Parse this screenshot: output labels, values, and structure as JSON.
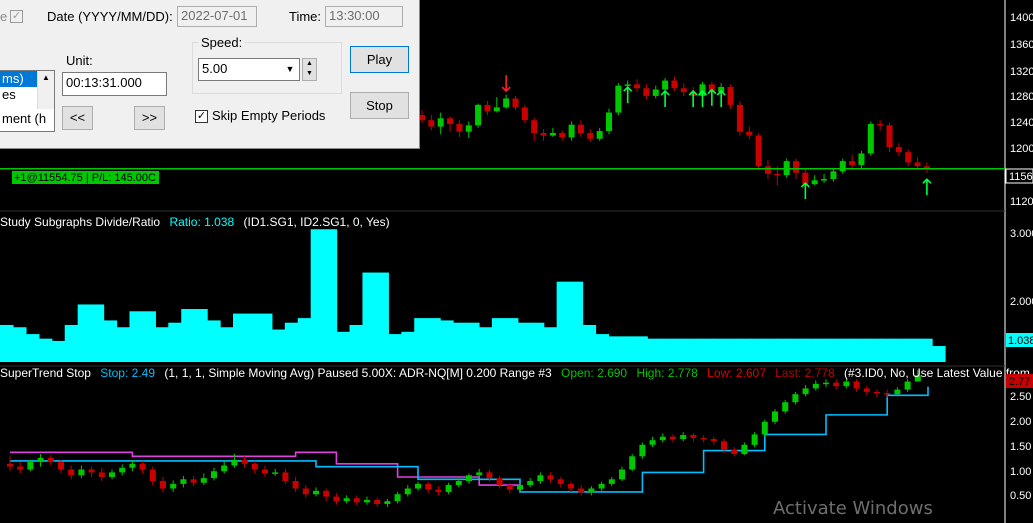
{
  "replay": {
    "date_label": "Date (YYYY/MM/DD):",
    "date_value": "2022-07-01",
    "time_label": "Time:",
    "time_value": "13:30:00",
    "left_cut_label": "e",
    "unit_label": "Unit:",
    "unit_value": "00:13:31.000",
    "list_items": [
      "ms)",
      "es",
      "ment (h"
    ],
    "back_label": "<<",
    "forward_label": ">>",
    "speed_label": "Speed:",
    "speed_value": "5.00",
    "skip_label": "Skip Empty Periods",
    "skip_checked": true,
    "play_label": "Play",
    "stop_label": "Stop"
  },
  "price_pane": {
    "axis_labels": [
      "1400",
      "1360",
      "1320",
      "1280",
      "1240",
      "1200",
      "1160",
      "1120"
    ],
    "current_price_box": "1156",
    "position_label": "+1@11554.75 | P/L: 145.00C"
  },
  "ratio_pane": {
    "title": "Study Subgraphs Divide/Ratio",
    "ratio_text": "Ratio: 1.038",
    "params": "(ID1.SG1, ID2.SG1, 0, Yes)",
    "axis_labels": [
      "3.000",
      "2.000"
    ],
    "last_value_box": "1.038"
  },
  "supertrend_pane": {
    "title": "SuperTrend Stop",
    "stop_text": "Stop: 2.49",
    "params": "(1, 1, 1, Simple Moving Avg)  Paused 5.00X: ADR-NQ[M]  0.200 Range  #3",
    "open_text": "Open: 2.690",
    "high_text": "High: 2.778",
    "low_text": "Low: 2.607",
    "last_text": "Last: 2.778",
    "tail_text": "(#3.ID0, No, Use Latest Value from Corre",
    "axis_labels": [
      "2.50",
      "2.00",
      "1.50",
      "1.00",
      "0.50"
    ],
    "last_value_box": "2.77"
  },
  "watermark": "Activate Windows",
  "colors": {
    "up": "#00c800",
    "down": "#c80000",
    "ratio": "#00ffff",
    "position_line": "#00c800",
    "stop_line_up": "#00bfff",
    "stop_line_down": "#e040e0",
    "arrow": "#00ff40"
  },
  "chart_data": [
    {
      "type": "candlestick",
      "title": "",
      "y_ticks": [
        1400,
        1360,
        1320,
        1280,
        1240,
        1200,
        1160,
        1120
      ],
      "ylim": [
        1090,
        1420
      ],
      "position_line": 1156,
      "candles": [
        [
          1240,
          1232,
          1248,
          1228
        ],
        [
          1232,
          1222,
          1240,
          1216
        ],
        [
          1222,
          1235,
          1244,
          1210
        ],
        [
          1235,
          1226,
          1238,
          1214
        ],
        [
          1226,
          1214,
          1232,
          1206
        ],
        [
          1214,
          1224,
          1230,
          1204
        ],
        [
          1224,
          1256,
          1258,
          1220
        ],
        [
          1256,
          1246,
          1262,
          1240
        ],
        [
          1246,
          1252,
          1268,
          1244
        ],
        [
          1252,
          1266,
          1272,
          1250
        ],
        [
          1266,
          1252,
          1270,
          1248
        ],
        [
          1252,
          1232,
          1256,
          1228
        ],
        [
          1232,
          1212,
          1236,
          1200
        ],
        [
          1212,
          1208,
          1218,
          1200
        ],
        [
          1208,
          1212,
          1220,
          1206
        ],
        [
          1212,
          1205,
          1216,
          1200
        ],
        [
          1205,
          1225,
          1230,
          1200
        ],
        [
          1225,
          1212,
          1232,
          1206
        ],
        [
          1212,
          1203,
          1218,
          1198
        ],
        [
          1203,
          1215,
          1220,
          1200
        ],
        [
          1215,
          1244,
          1250,
          1210
        ],
        [
          1244,
          1286,
          1290,
          1240
        ],
        [
          1286,
          1288,
          1294,
          1282
        ],
        [
          1288,
          1282,
          1296,
          1276
        ],
        [
          1282,
          1270,
          1288,
          1264
        ],
        [
          1270,
          1280,
          1286,
          1266
        ],
        [
          1280,
          1294,
          1298,
          1276
        ],
        [
          1294,
          1282,
          1300,
          1278
        ],
        [
          1282,
          1276,
          1290,
          1270
        ],
        [
          1276,
          1270,
          1284,
          1264
        ],
        [
          1270,
          1288,
          1292,
          1266
        ],
        [
          1288,
          1276,
          1292,
          1272
        ],
        [
          1276,
          1284,
          1290,
          1270
        ],
        [
          1284,
          1256,
          1288,
          1250
        ],
        [
          1256,
          1214,
          1262,
          1208
        ],
        [
          1214,
          1208,
          1222,
          1202
        ],
        [
          1208,
          1160,
          1212,
          1154
        ],
        [
          1160,
          1148,
          1170,
          1140
        ],
        [
          1148,
          1146,
          1160,
          1130
        ],
        [
          1146,
          1168,
          1172,
          1142
        ],
        [
          1168,
          1150,
          1172,
          1140
        ],
        [
          1150,
          1132,
          1156,
          1126
        ],
        [
          1132,
          1138,
          1146,
          1130
        ],
        [
          1138,
          1140,
          1148,
          1134
        ],
        [
          1140,
          1152,
          1156,
          1136
        ],
        [
          1152,
          1168,
          1172,
          1148
        ],
        [
          1168,
          1162,
          1178,
          1154
        ],
        [
          1162,
          1180,
          1184,
          1156
        ],
        [
          1180,
          1226,
          1230,
          1176
        ],
        [
          1226,
          1224,
          1232,
          1216
        ],
        [
          1224,
          1190,
          1228,
          1182
        ],
        [
          1190,
          1182,
          1196,
          1176
        ],
        [
          1182,
          1166,
          1186,
          1160
        ],
        [
          1166,
          1160,
          1174,
          1154
        ],
        [
          1160,
          1156,
          1166,
          1150
        ]
      ]
    },
    {
      "type": "bar",
      "title": "Study Subgraphs Divide/Ratio",
      "y_ticks": [
        3.0,
        2.0
      ],
      "ylim": [
        0.6,
        4.0
      ],
      "values": [
        1.5,
        1.45,
        1.3,
        1.2,
        1.15,
        1.5,
        1.95,
        1.95,
        1.6,
        1.45,
        1.8,
        1.8,
        1.45,
        1.55,
        1.85,
        1.85,
        1.6,
        1.45,
        1.75,
        1.75,
        1.75,
        1.4,
        1.55,
        1.65,
        3.6,
        3.6,
        1.35,
        1.5,
        2.65,
        2.65,
        1.3,
        1.35,
        1.65,
        1.65,
        1.6,
        1.55,
        1.55,
        1.45,
        1.65,
        1.65,
        1.55,
        1.55,
        1.45,
        2.45,
        2.45,
        1.5,
        1.3,
        1.25,
        1.25,
        1.25,
        1.2,
        1.2,
        1.2,
        1.2,
        1.2,
        1.2,
        1.2,
        1.2,
        1.2,
        1.2,
        1.2,
        1.2,
        1.2,
        1.2,
        1.2,
        1.2,
        1.2,
        1.2,
        1.2,
        1.2,
        1.2,
        1.2,
        1.038
      ]
    },
    {
      "type": "candlestick",
      "title": "SuperTrend Stop",
      "y_ticks": [
        2.5,
        2.0,
        1.5,
        1.0,
        0.5
      ],
      "ylim": [
        0.12,
        2.85
      ],
      "candles": [
        [
          1.15,
          1.1,
          1.28,
          1.02
        ],
        [
          1.1,
          1.05,
          1.18,
          0.98
        ],
        [
          1.05,
          1.18,
          1.22,
          1.02
        ],
        [
          1.18,
          1.25,
          1.32,
          1.1
        ],
        [
          1.25,
          1.18,
          1.3,
          1.12
        ],
        [
          1.18,
          1.05,
          1.22,
          0.98
        ],
        [
          1.05,
          0.95,
          1.12,
          0.88
        ],
        [
          0.95,
          1.05,
          1.12,
          0.9
        ],
        [
          1.05,
          1.0,
          1.1,
          0.92
        ],
        [
          1.0,
          0.92,
          1.08,
          0.85
        ],
        [
          0.92,
          1.0,
          1.05,
          0.88
        ],
        [
          1.0,
          1.08,
          1.14,
          0.95
        ],
        [
          1.08,
          1.15,
          1.22,
          1.02
        ],
        [
          1.15,
          1.05,
          1.2,
          0.98
        ],
        [
          1.05,
          0.85,
          1.1,
          0.78
        ],
        [
          0.85,
          0.72,
          0.92,
          0.65
        ],
        [
          0.72,
          0.8,
          0.86,
          0.66
        ],
        [
          0.8,
          0.88,
          0.94,
          0.74
        ],
        [
          0.88,
          0.82,
          0.94,
          0.76
        ],
        [
          0.82,
          0.9,
          0.98,
          0.78
        ],
        [
          0.9,
          1.02,
          1.08,
          0.86
        ],
        [
          1.02,
          1.12,
          1.2,
          0.98
        ],
        [
          1.12,
          1.22,
          1.32,
          1.08
        ],
        [
          1.22,
          1.15,
          1.28,
          1.08
        ],
        [
          1.15,
          1.05,
          1.2,
          0.98
        ],
        [
          1.05,
          0.98,
          1.12,
          0.92
        ],
        [
          0.98,
          1.0,
          1.06,
          0.94
        ],
        [
          1.0,
          0.85,
          1.06,
          0.8
        ],
        [
          0.85,
          0.72,
          0.92,
          0.66
        ],
        [
          0.72,
          0.62,
          0.78,
          0.56
        ],
        [
          0.62,
          0.68,
          0.74,
          0.58
        ],
        [
          0.68,
          0.58,
          0.72,
          0.5
        ],
        [
          0.58,
          0.5,
          0.64,
          0.44
        ],
        [
          0.5,
          0.55,
          0.6,
          0.46
        ],
        [
          0.55,
          0.48,
          0.6,
          0.42
        ],
        [
          0.48,
          0.52,
          0.58,
          0.44
        ],
        [
          0.52,
          0.45,
          0.56,
          0.4
        ],
        [
          0.45,
          0.5,
          0.54,
          0.4
        ],
        [
          0.5,
          0.62,
          0.66,
          0.46
        ],
        [
          0.62,
          0.72,
          0.78,
          0.58
        ],
        [
          0.72,
          0.8,
          0.84,
          0.68
        ],
        [
          0.8,
          0.7,
          0.84,
          0.64
        ],
        [
          0.7,
          0.66,
          0.76,
          0.6
        ],
        [
          0.66,
          0.78,
          0.82,
          0.62
        ],
        [
          0.78,
          0.85,
          0.9,
          0.74
        ],
        [
          0.85,
          0.95,
          0.98,
          0.8
        ],
        [
          0.95,
          1.0,
          1.06,
          0.9
        ],
        [
          1.0,
          0.9,
          1.05,
          0.84
        ],
        [
          0.9,
          0.78,
          0.94,
          0.72
        ],
        [
          0.78,
          0.7,
          0.82,
          0.64
        ],
        [
          0.7,
          0.78,
          0.82,
          0.66
        ],
        [
          0.78,
          0.85,
          0.9,
          0.74
        ],
        [
          0.85,
          0.95,
          1.0,
          0.8
        ],
        [
          0.95,
          0.88,
          1.0,
          0.82
        ],
        [
          0.88,
          0.8,
          0.92,
          0.74
        ],
        [
          0.8,
          0.72,
          0.84,
          0.66
        ],
        [
          0.72,
          0.65,
          0.78,
          0.6
        ],
        [
          0.65,
          0.72,
          0.76,
          0.6
        ],
        [
          0.72,
          0.8,
          0.84,
          0.68
        ],
        [
          0.8,
          0.88,
          0.92,
          0.76
        ],
        [
          0.88,
          1.05,
          1.1,
          0.85
        ],
        [
          1.05,
          1.28,
          1.32,
          1.02
        ],
        [
          1.28,
          1.48,
          1.52,
          1.24
        ],
        [
          1.48,
          1.56,
          1.62,
          1.44
        ],
        [
          1.56,
          1.62,
          1.68,
          1.52
        ],
        [
          1.62,
          1.58,
          1.66,
          1.52
        ],
        [
          1.58,
          1.65,
          1.7,
          1.54
        ],
        [
          1.65,
          1.6,
          1.68,
          1.54
        ],
        [
          1.6,
          1.58,
          1.64,
          1.52
        ],
        [
          1.58,
          1.54,
          1.62,
          1.48
        ],
        [
          1.54,
          1.4,
          1.58,
          1.34
        ],
        [
          1.4,
          1.32,
          1.44,
          1.28
        ],
        [
          1.32,
          1.48,
          1.52,
          1.3
        ],
        [
          1.48,
          1.66,
          1.7,
          1.44
        ],
        [
          1.66,
          1.88,
          1.92,
          1.62
        ],
        [
          1.88,
          2.06,
          2.1,
          1.84
        ],
        [
          2.06,
          2.22,
          2.26,
          2.02
        ],
        [
          2.22,
          2.36,
          2.4,
          2.18
        ],
        [
          2.36,
          2.46,
          2.52,
          2.32
        ],
        [
          2.46,
          2.54,
          2.6,
          2.42
        ],
        [
          2.54,
          2.56,
          2.62,
          2.48
        ],
        [
          2.56,
          2.5,
          2.62,
          2.44
        ],
        [
          2.5,
          2.58,
          2.64,
          2.46
        ],
        [
          2.58,
          2.46,
          2.62,
          2.4
        ],
        [
          2.46,
          2.4,
          2.5,
          2.34
        ],
        [
          2.4,
          2.38,
          2.44,
          2.3
        ],
        [
          2.38,
          2.36,
          2.44,
          2.3
        ],
        [
          2.36,
          2.44,
          2.48,
          2.32
        ],
        [
          2.44,
          2.58,
          2.62,
          2.4
        ],
        [
          2.58,
          2.69,
          2.778,
          2.607
        ]
      ],
      "stop_up": [
        [
          0,
          1.2
        ],
        [
          22,
          1.2
        ],
        [
          30,
          1.1
        ],
        [
          40,
          0.88
        ],
        [
          50,
          0.66
        ],
        [
          56,
          0.66
        ],
        [
          62,
          1.0
        ],
        [
          68,
          1.38
        ],
        [
          74,
          1.66
        ],
        [
          80,
          2.0
        ],
        [
          86,
          2.34
        ],
        [
          90,
          2.49
        ]
      ],
      "stop_down": [
        [
          0,
          1.35
        ],
        [
          12,
          1.28
        ],
        [
          28,
          1.35
        ],
        [
          32,
          1.15
        ],
        [
          38,
          0.92
        ],
        [
          46,
          0.78
        ],
        [
          50,
          0.66
        ]
      ]
    }
  ]
}
